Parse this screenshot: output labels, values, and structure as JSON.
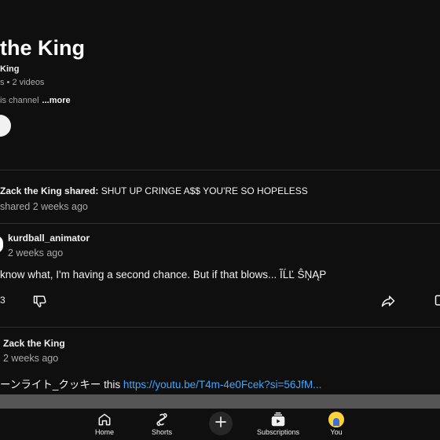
{
  "channel": {
    "title": "the King",
    "handle": "King",
    "stats": "s • 2 videos",
    "description": "is channel",
    "more_label": "...more"
  },
  "posts": [
    {
      "shared_by": "Zack the King shared:",
      "shared_text": " SHUT UP CRINGE A$$ YOU'RE SO HOPELESS",
      "shared_meta": "shared 2 weeks ago"
    },
    {
      "author": "kurdball_animator",
      "time": "2 weeks ago",
      "body": "know what, I'm having a second chance. But if that blows... ĨĹĽ ŜŅĄP",
      "like_count": "3"
    },
    {
      "author": "Zack the King",
      "time": "2 weeks ago",
      "body_prefix": "ーンライト_クッキー this ",
      "link": "https://youtu.be/T4m-4e0Fcek?si=56JfM..."
    }
  ],
  "nav": {
    "home": "Home",
    "shorts": "Shorts",
    "subscriptions": "Subscriptions",
    "you": "You"
  }
}
